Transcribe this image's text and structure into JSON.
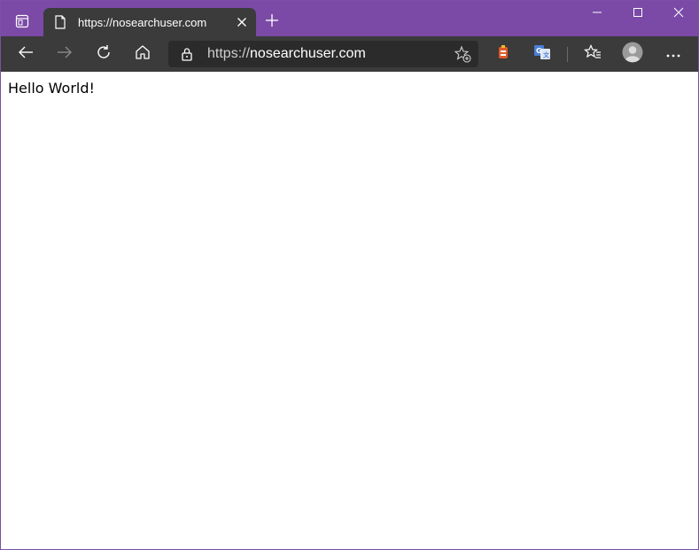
{
  "tab": {
    "title": "https://nosearchuser.com",
    "close_icon": "close-icon",
    "favicon": "page-icon"
  },
  "toolbar": {
    "url_protocol": "https://",
    "url_host": "nosearchuser.com",
    "icons": [
      "back-arrow-icon",
      "forward-arrow-icon",
      "refresh-icon",
      "home-icon",
      "lock-icon",
      "add-favorite-icon",
      "extension-icon",
      "translate-icon",
      "favorites-icon",
      "profile-avatar-icon",
      "more-icon"
    ]
  },
  "window_controls": [
    "minimize-icon",
    "maximize-icon",
    "close-window-icon"
  ],
  "page": {
    "text": "Hello World!"
  },
  "colors": {
    "titlebar": "#7a4aa6",
    "toolbar": "#3b3b3b",
    "addressbar": "#2b2b2b"
  }
}
